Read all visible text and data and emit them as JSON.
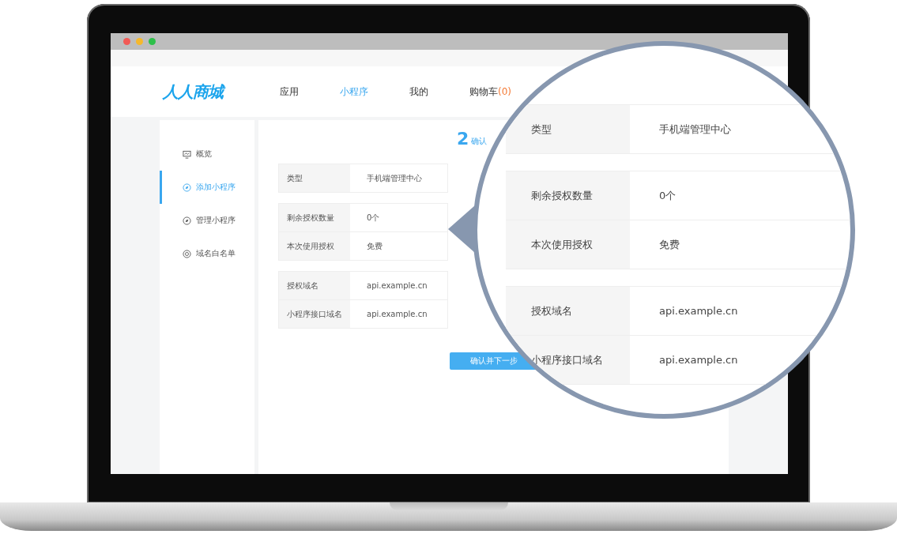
{
  "nav": {
    "logo": "人人商城",
    "items": [
      {
        "label": "应用",
        "selected": false
      },
      {
        "label": "小程序",
        "selected": true
      },
      {
        "label": "我的",
        "selected": false
      },
      {
        "label": "购物车",
        "selected": false,
        "count": "(0)"
      }
    ]
  },
  "sidebar": {
    "items": [
      {
        "label": "概览",
        "selected": false,
        "kind": "monitor"
      },
      {
        "label": "添加小程序",
        "selected": true,
        "kind": "compass"
      },
      {
        "label": "管理小程序",
        "selected": false,
        "kind": "compass"
      },
      {
        "label": "域名白名单",
        "selected": false,
        "kind": "target"
      }
    ]
  },
  "step": {
    "number": "2",
    "label": "确认"
  },
  "table": {
    "groups": [
      [
        {
          "label": "类型",
          "value": "手机端管理中心"
        }
      ],
      [
        {
          "label": "剩余授权数量",
          "value": "0个"
        },
        {
          "label": "本次使用授权",
          "value": "免费"
        }
      ],
      [
        {
          "label": "授权域名",
          "value": "api.example.cn"
        },
        {
          "label": "小程序接口域名",
          "value": "api.example.cn"
        }
      ]
    ]
  },
  "next_button": "确认并下一步",
  "magnifier": {
    "groups": [
      [
        {
          "label": "类型",
          "value": "手机端管理中心"
        }
      ],
      [
        {
          "label": "剩余授权数量",
          "value": "0个"
        },
        {
          "label": "本次使用授权",
          "value": "免费"
        }
      ],
      [
        {
          "label": "授权域名",
          "value": "api.example.cn"
        },
        {
          "label": "小程序接口域名",
          "value": "api.example.cn"
        }
      ]
    ]
  }
}
